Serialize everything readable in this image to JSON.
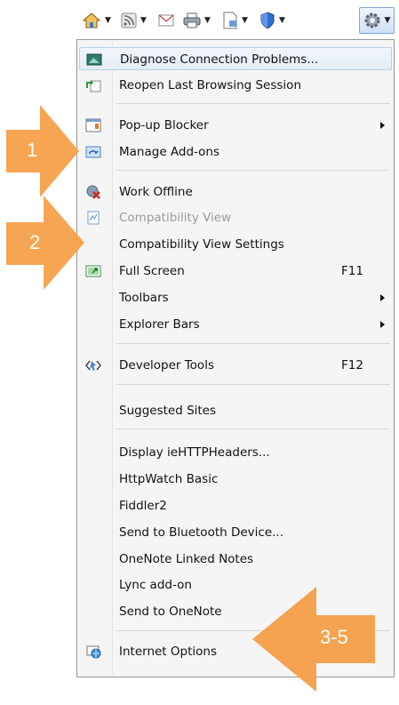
{
  "menu": {
    "items": [
      {
        "label": "Diagnose Connection Problems...",
        "icon": "diagnose-icon"
      },
      {
        "label": "Reopen Last Browsing Session",
        "icon": "reopen-session-icon"
      },
      {
        "label": "Pop-up Blocker",
        "icon": "popup-blocker-icon"
      },
      {
        "label": "Manage Add-ons",
        "icon": "manage-addons-icon"
      },
      {
        "label": "Work Offline",
        "icon": "work-offline-icon"
      },
      {
        "label": "Compatibility View",
        "icon": "compatibility-view-icon"
      },
      {
        "label": "Compatibility View Settings"
      },
      {
        "label": "Full Screen",
        "shortcut": "F11",
        "icon": "full-screen-icon"
      },
      {
        "label": "Toolbars"
      },
      {
        "label": "Explorer Bars"
      },
      {
        "label": "Developer Tools",
        "shortcut": "F12",
        "icon": "developer-tools-icon"
      },
      {
        "label": "Suggested Sites"
      },
      {
        "label": "Display ieHTTPHeaders..."
      },
      {
        "label": "HttpWatch Basic"
      },
      {
        "label": "Fiddler2"
      },
      {
        "label": "Send to Bluetooth Device..."
      },
      {
        "label": "OneNote Linked Notes"
      },
      {
        "label": "Lync add-on"
      },
      {
        "label": "Send to OneNote"
      },
      {
        "label": "Internet Options",
        "icon": "internet-options-icon"
      }
    ]
  },
  "callouts": [
    {
      "label": "1"
    },
    {
      "label": "2"
    },
    {
      "label": "3-5"
    }
  ],
  "colors": {
    "callout": "#f5a04a",
    "callout_text": "#ffffff",
    "highlight_border": "#b9cfe8"
  }
}
